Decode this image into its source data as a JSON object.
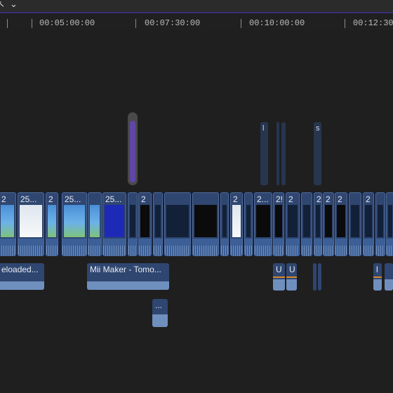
{
  "window": {
    "accent_color": "#3b2f7a"
  },
  "toolbar": {
    "select_tool_icon": "arrow-cursor-icon",
    "dropdown_icon": "chevron-down-icon",
    "arrow_glyph": "↖",
    "chevron_glyph": "⌄"
  },
  "ruler": {
    "labels": [
      "00:05:00:00",
      "00:07:30:00",
      "00:10:00:00",
      "00:12:30"
    ]
  },
  "primary_clips": [
    {
      "title": "2"
    },
    {
      "title": "25..."
    },
    {
      "title": "2"
    },
    {
      "title": "25..."
    },
    {
      "title": ""
    },
    {
      "title": "25..."
    },
    {
      "title": ""
    },
    {
      "title": "2"
    },
    {
      "title": "2"
    },
    {
      "title": "2!"
    },
    {
      "title": "2..."
    },
    {
      "title": "2!"
    },
    {
      "title": "2"
    },
    {
      "title": "2"
    },
    {
      "title": "2"
    },
    {
      "title": "2"
    },
    {
      "title": "2"
    }
  ],
  "connected_clips": [
    {
      "title": "l"
    },
    {
      "title": "s"
    }
  ],
  "audio_clips": [
    {
      "title": "eloaded..."
    },
    {
      "title": "Mii Maker - Tomo..."
    },
    {
      "title": "..."
    },
    {
      "title": "U"
    },
    {
      "title": "U"
    },
    {
      "title": "l"
    }
  ],
  "colors": {
    "clip_blue": "#2f4670",
    "selected_purple": "#6046a8",
    "marker_orange": "#d68a2a"
  }
}
